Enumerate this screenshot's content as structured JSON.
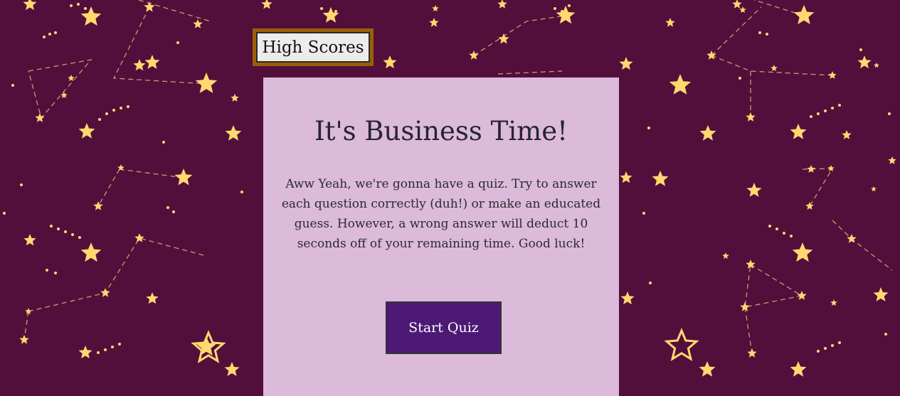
{
  "header": {
    "high_scores_label": "High Scores"
  },
  "intro": {
    "title": "It's Business Time!",
    "description": "Aww Yeah, we're gonna have a quiz. Try to answer each question correctly (duh!) or make an educated guess. However, a wrong answer will deduct 10 seconds off of your remaining time. Good luck!",
    "start_label": "Start Quiz"
  },
  "colors": {
    "background": "#520f3c",
    "star": "#ffd86e",
    "card": "#dcbad9",
    "button": "#4c1975",
    "high_scores_border": "#9a5f06"
  }
}
